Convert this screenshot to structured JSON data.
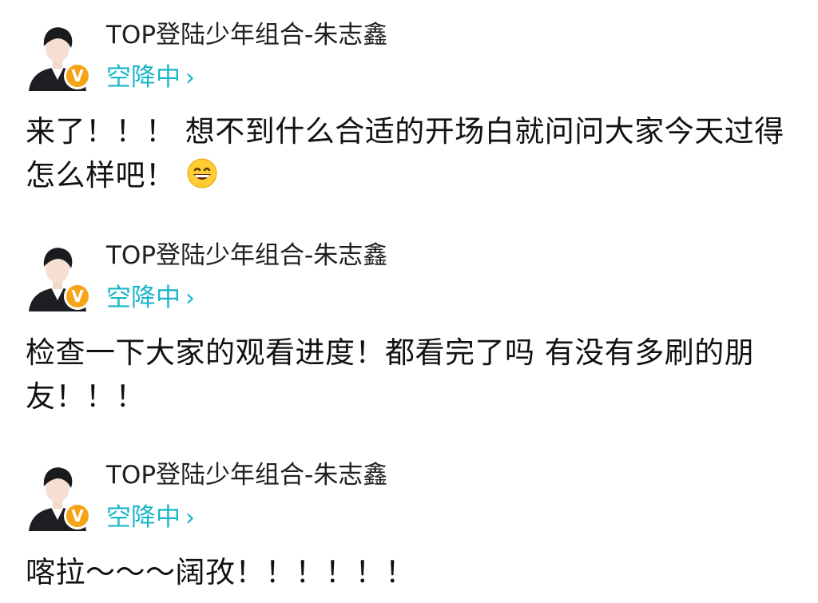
{
  "posts": [
    {
      "username": "TOP登陆少年组合-朱志鑫",
      "status": "空降中",
      "status_chevron": "›",
      "badge": "V",
      "text": "来了！！！ 想不到什么合适的开场白就问问大家今天过得怎么样吧！",
      "emoji": "grinning-face-icon"
    },
    {
      "username": "TOP登陆少年组合-朱志鑫",
      "status": "空降中",
      "status_chevron": "›",
      "badge": "V",
      "text": "检查一下大家的观看进度！都看完了吗 有没有多刷的朋友！！！"
    },
    {
      "username": "TOP登陆少年组合-朱志鑫",
      "status": "空降中",
      "status_chevron": "›",
      "badge": "V",
      "text": "喀拉～～～阔孜！！！！！！"
    }
  ],
  "colors": {
    "accent": "#19b6c9",
    "badge": "#f6a417",
    "text": "#111111"
  }
}
